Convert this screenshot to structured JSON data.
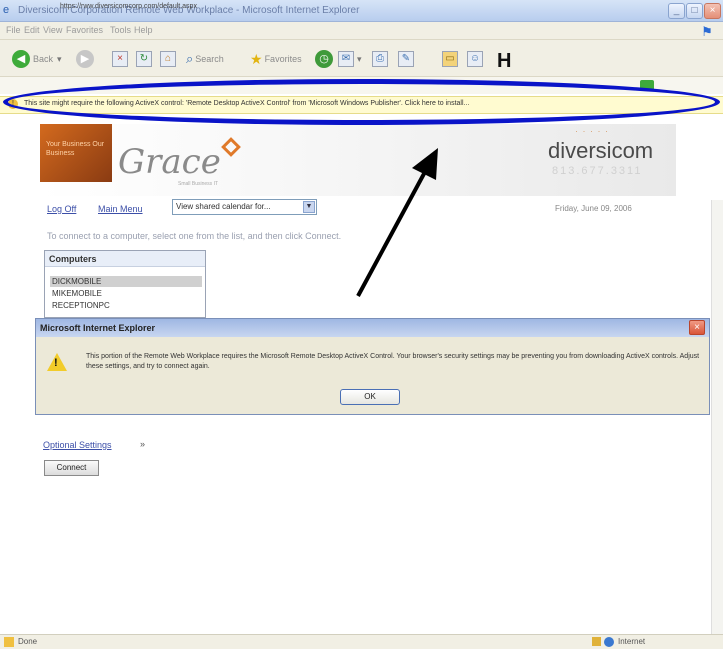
{
  "window": {
    "title": "Diversicom Corporation Remote Web Workplace - Microsoft Internet Explorer",
    "minimize_glyph": "_",
    "maximize_glyph": "□",
    "close_glyph": "×"
  },
  "menu": {
    "items": [
      "File",
      "Edit",
      "View",
      "Favorites",
      "Tools",
      "Help"
    ]
  },
  "toolbar": {
    "back_label": "Back",
    "search_label": "Search",
    "favorites_label": "Favorites"
  },
  "address": {
    "url": "https://rww.diversicomcorp.com/default.aspx"
  },
  "infobar": {
    "text": "This site might require the following ActiveX control: 'Remote Desktop ActiveX Control' from 'Microsoft Windows Publisher'. Click here to install..."
  },
  "banner": {
    "photo_text": "Your Business Our Business",
    "logo_text": "Grace",
    "tagline": "Small Business IT",
    "company": "diversicom",
    "phone": "813.677.3311"
  },
  "nav": {
    "logoff": "Log Off",
    "main_menu": "Main Menu",
    "calendar_select": "View shared calendar for...",
    "date": "Friday, June 09, 2006"
  },
  "page": {
    "instruction": "To connect to a computer, select one from the list, and then click Connect.",
    "computers_header": "Computers",
    "computers": [
      "DICKMOBILE",
      "MIKEMOBILE",
      "RECEPTIONPC"
    ],
    "optional_settings": "Optional Settings",
    "connect": "Connect"
  },
  "dialog": {
    "title": "Microsoft Internet Explorer",
    "message": "This portion of the Remote Web Workplace requires the Microsoft Remote Desktop ActiveX Control. Your browser's security settings may be preventing you from downloading ActiveX controls. Adjust these settings, and try to connect again.",
    "ok": "OK"
  },
  "status": {
    "left": "Done",
    "zone": "Internet"
  },
  "colors": {
    "highlight_ellipse": "#0a14c8",
    "arrow": "#000000"
  }
}
